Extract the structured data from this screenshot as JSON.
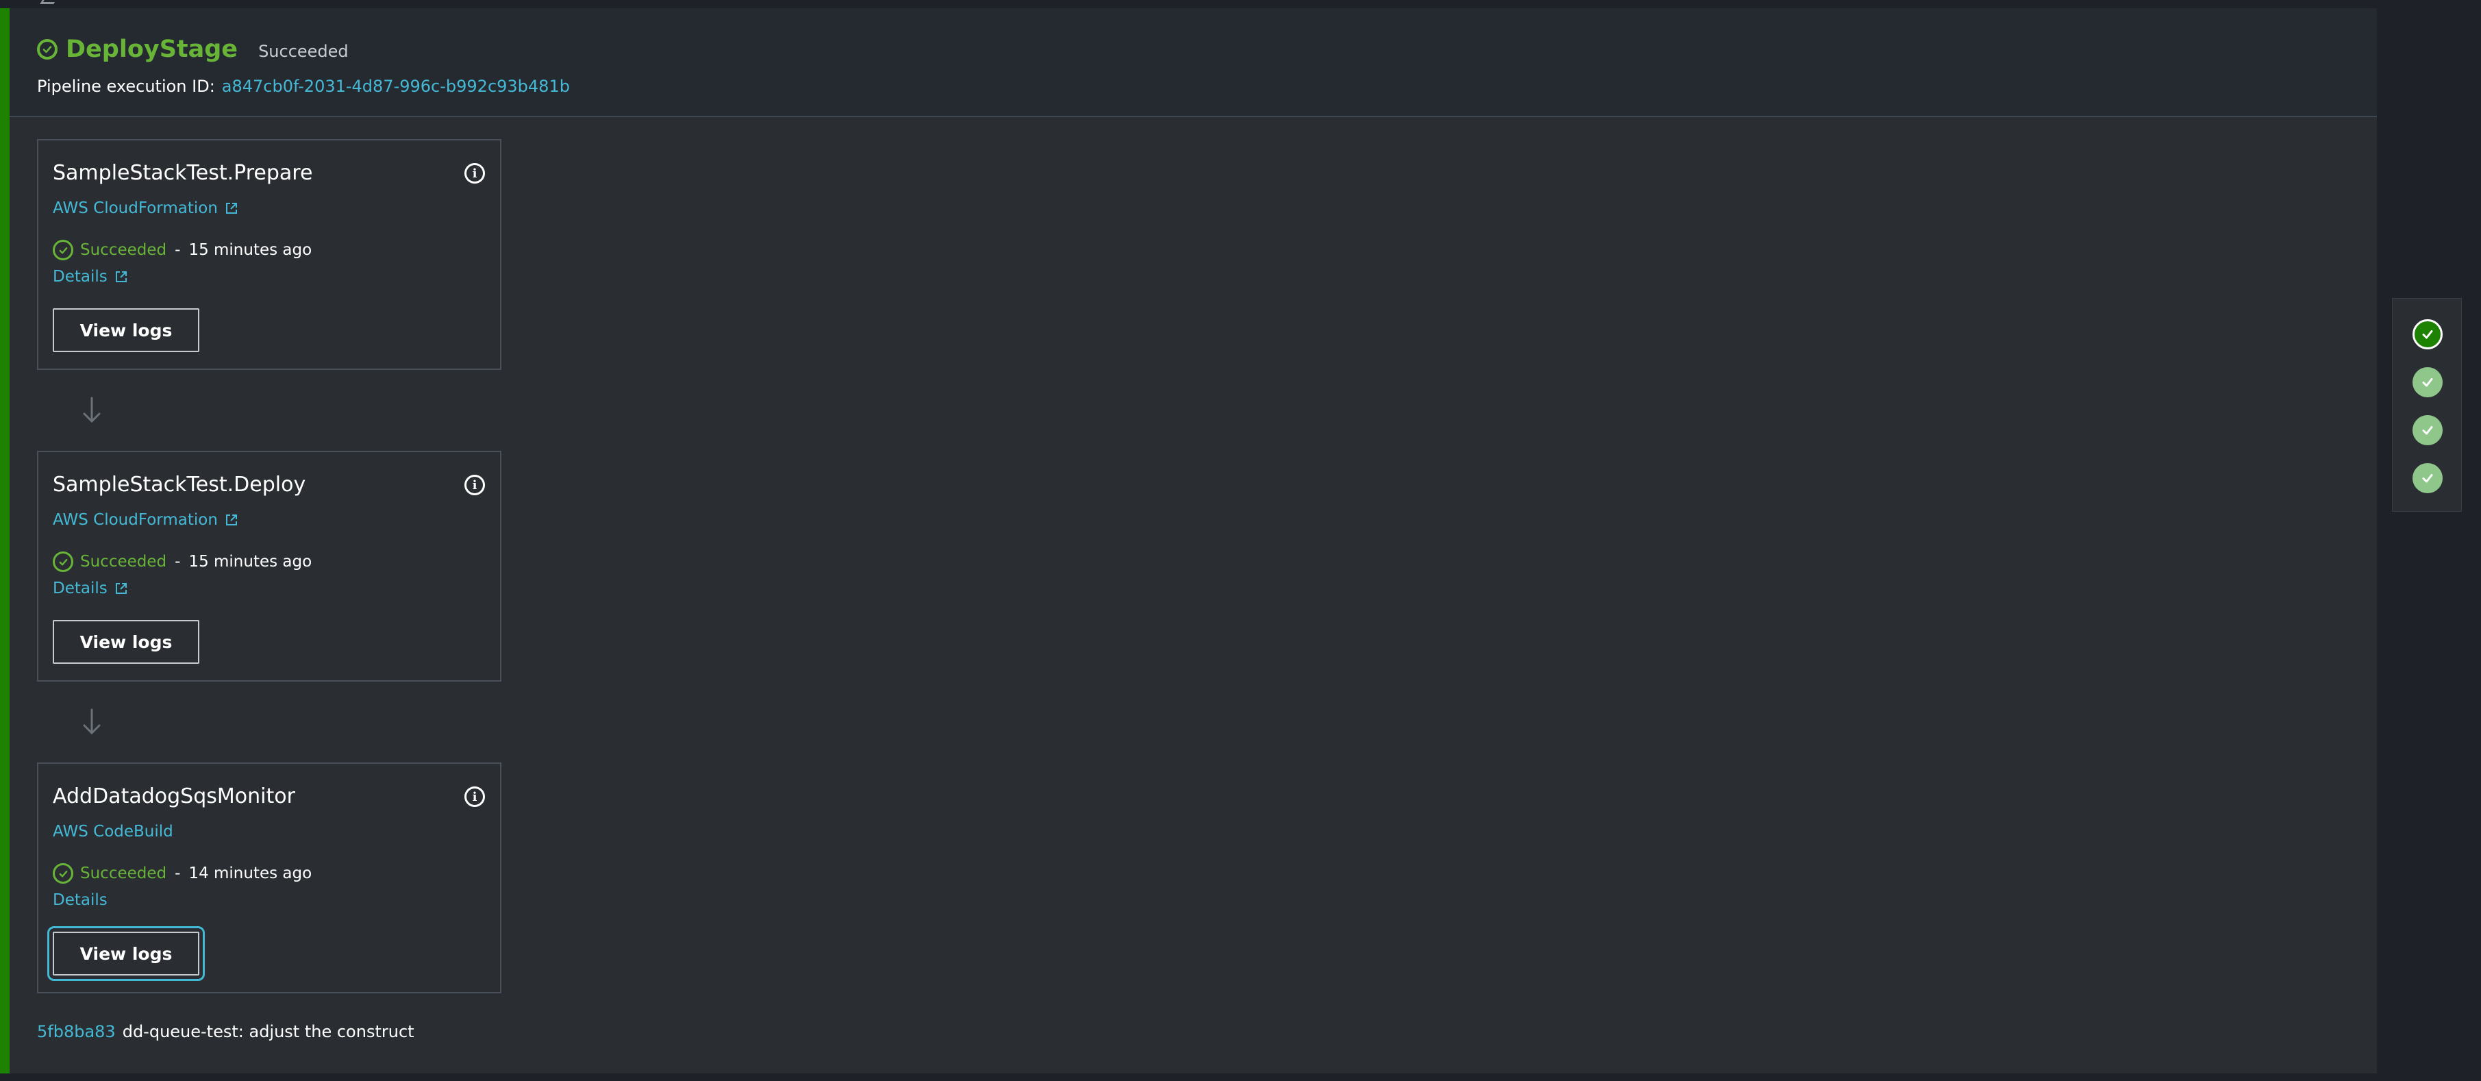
{
  "stage": {
    "name": "DeployStage",
    "status": "Succeeded",
    "execution_label": "Pipeline execution ID:",
    "execution_id": "a847cb0f-2031-4d87-996c-b992c93b481b"
  },
  "actions": [
    {
      "name": "SampleStackTest.Prepare",
      "provider": "AWS CloudFormation",
      "status": "Succeeded",
      "separator": "-",
      "time": "15 minutes ago",
      "details_label": "Details",
      "logs_label": "View logs"
    },
    {
      "name": "SampleStackTest.Deploy",
      "provider": "AWS CloudFormation",
      "status": "Succeeded",
      "separator": "-",
      "time": "15 minutes ago",
      "details_label": "Details",
      "logs_label": "View logs"
    },
    {
      "name": "AddDatadogSqsMonitor",
      "provider": "AWS CodeBuild",
      "status": "Succeeded",
      "separator": "-",
      "time": "14 minutes ago",
      "details_label": "Details",
      "logs_label": "View logs"
    }
  ],
  "commit": {
    "hash": "5fb8ba83",
    "message": "dd-queue-test: adjust the construct"
  },
  "stage_nav": {
    "count": 4,
    "active_index": 0
  },
  "colors": {
    "success": "#67b437",
    "success_border": "#1d8102",
    "link": "#44b9d6",
    "background": "#2a2e33"
  }
}
